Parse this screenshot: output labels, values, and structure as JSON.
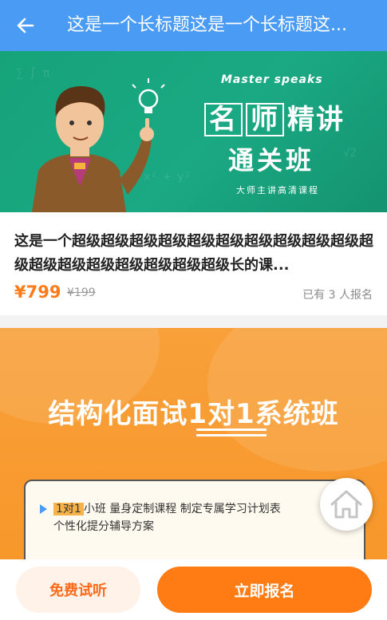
{
  "header": {
    "title": "这是一个长标题这是一个长标题这..."
  },
  "banner1": {
    "tagline_en": "Master speaks",
    "title_box1": "名",
    "title_box2": "师",
    "title_rest": "精讲",
    "subtitle": "通关班",
    "caption": "大师主讲高清课程"
  },
  "course": {
    "title": "这是一个超级超级超级超级超级超级超级超级超级超级超级超级超级超级超级超级超级超级长的课...",
    "price": "¥799",
    "original_price": "¥199",
    "enrolled": "已有 3 人报名"
  },
  "banner2": {
    "title": "结构化面试1对1系统班",
    "row1_highlight": "1对1",
    "row1_text": "小班  量身定制课程  制定专属学习计划表",
    "row1_text2": "个性化提分辅导方案"
  },
  "actions": {
    "trial_label": "免费试听",
    "signup_label": "立即报名"
  },
  "colors": {
    "header_bg": "#4a9bf3",
    "accent": "#ff7b14",
    "price": "#ff7a18"
  },
  "icons": {
    "back": "arrow-left-icon",
    "home": "home-icon"
  }
}
